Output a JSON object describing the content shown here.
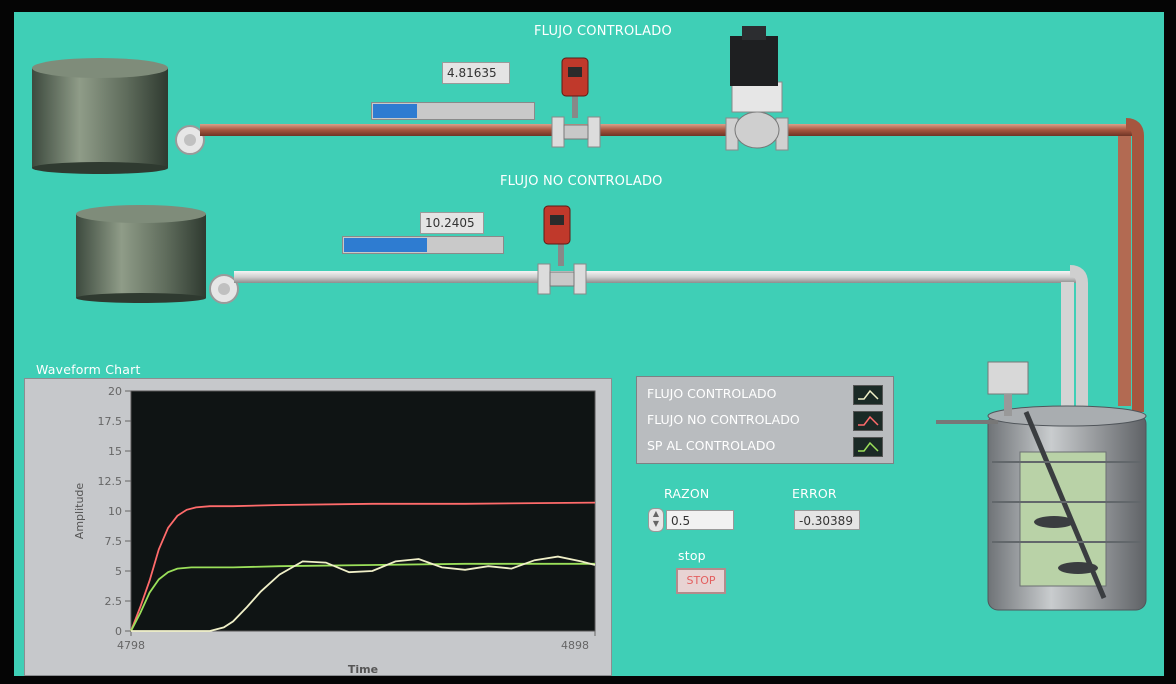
{
  "top_flow": {
    "title": "FLUJO CONTROLADO",
    "value": "4.81635",
    "fill_fraction": 0.27
  },
  "bottom_flow": {
    "title": "FLUJO NO CONTROLADO",
    "value": "10.2405",
    "fill_fraction": 0.52
  },
  "legend": [
    {
      "label": "FLUJO CONTROLADO",
      "color": "#f0f0c8"
    },
    {
      "label": "FLUJO NO CONTROLADO",
      "color": "#ff6b6b"
    },
    {
      "label": "SP AL CONTROLADO",
      "color": "#9be05a"
    }
  ],
  "razon": {
    "label": "RAZON",
    "value": "0.5"
  },
  "error": {
    "label": "ERROR",
    "value": "-0.30389"
  },
  "stop": {
    "label": "stop",
    "button": "STOP"
  },
  "colors": {
    "background": "#3fcfb6",
    "pipe_controlled": "#b26a52",
    "pipe_uncontrolled": "#d8d8d8",
    "plot_bg": "#0f1414"
  },
  "chart_data": {
    "type": "line",
    "title": "Waveform Chart",
    "xlabel": "Time",
    "ylabel": "Amplitude",
    "xlim": [
      4798,
      4898
    ],
    "ylim": [
      0,
      20
    ],
    "x_ticks": [
      "4798",
      "4898"
    ],
    "y_ticks": [
      "0",
      "2.5",
      "5",
      "7.5",
      "10",
      "12.5",
      "15",
      "17.5",
      "20"
    ],
    "grid": false,
    "series": [
      {
        "name": "FLUJO NO CONTROLADO",
        "color": "#ff6b6b",
        "x": [
          4798,
          4800,
          4802,
          4804,
          4806,
          4808,
          4810,
          4812,
          4815,
          4820,
          4830,
          4850,
          4870,
          4898
        ],
        "y": [
          0,
          2,
          4.2,
          6.8,
          8.6,
          9.6,
          10.1,
          10.3,
          10.4,
          10.4,
          10.5,
          10.6,
          10.6,
          10.7
        ]
      },
      {
        "name": "SP AL CONTROLADO",
        "color": "#9be05a",
        "x": [
          4798,
          4800,
          4802,
          4804,
          4806,
          4808,
          4811,
          4815,
          4820,
          4830,
          4850,
          4870,
          4898
        ],
        "y": [
          0,
          1.5,
          3.2,
          4.3,
          4.9,
          5.2,
          5.3,
          5.3,
          5.3,
          5.4,
          5.5,
          5.6,
          5.6
        ]
      },
      {
        "name": "FLUJO CONTROLADO",
        "color": "#f0f0c8",
        "x": [
          4798,
          4810,
          4815,
          4818,
          4820,
          4823,
          4826,
          4830,
          4835,
          4840,
          4845,
          4850,
          4855,
          4860,
          4865,
          4870,
          4875,
          4880,
          4885,
          4890,
          4895,
          4898
        ],
        "y": [
          0,
          0,
          0,
          0.3,
          0.8,
          2.0,
          3.3,
          4.7,
          5.8,
          5.7,
          4.9,
          5.0,
          5.8,
          6.0,
          5.3,
          5.1,
          5.4,
          5.2,
          5.9,
          6.2,
          5.8,
          5.5
        ]
      }
    ]
  }
}
